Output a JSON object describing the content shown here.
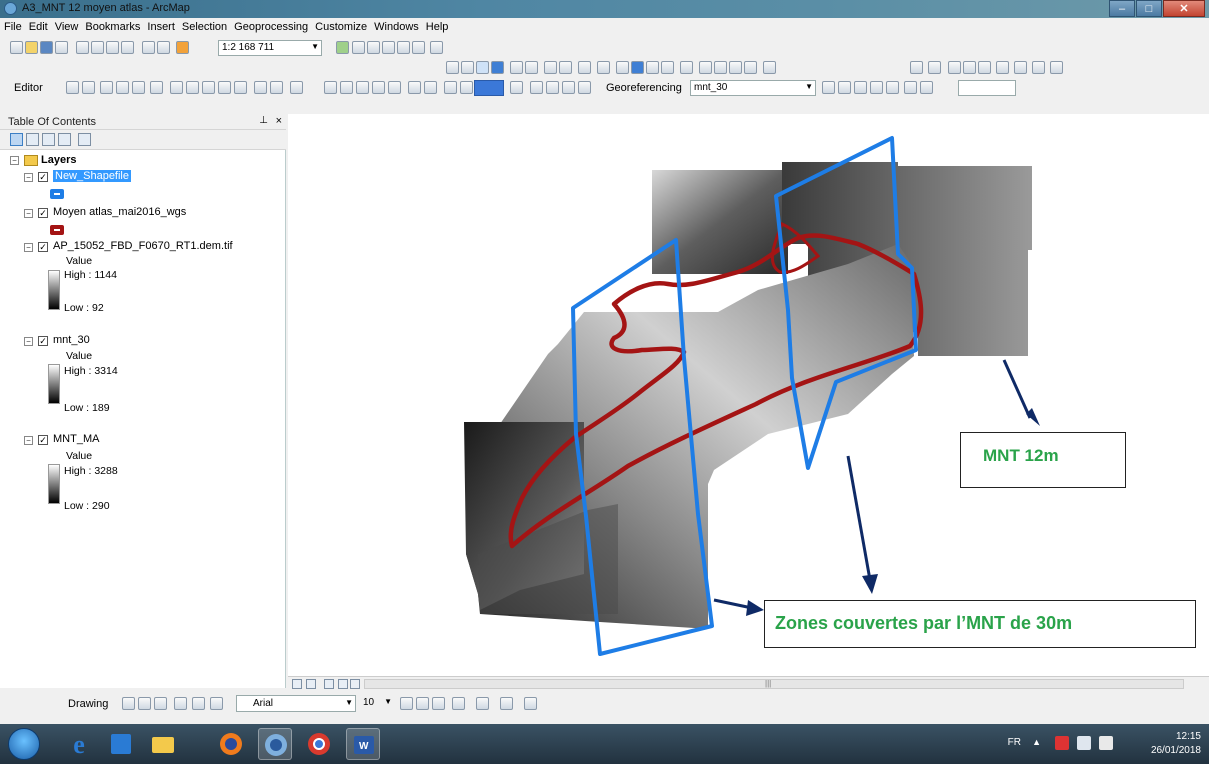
{
  "window": {
    "title": "A3_MNT 12 moyen atlas - ArcMap",
    "controls": [
      "minimize-icon",
      "maximize-icon",
      "close-icon"
    ]
  },
  "menu": [
    "File",
    "Edit",
    "View",
    "Bookmarks",
    "Insert",
    "Selection",
    "Geoprocessing",
    "Customize",
    "Windows",
    "Help"
  ],
  "toolbar": {
    "scale": "1:2 168 711",
    "editor_label": "Editor",
    "georeferencing_label": "Georeferencing",
    "georeferencing_layer": "mnt_30"
  },
  "toc": {
    "title": "Table Of Contents",
    "root": "Layers",
    "layers": [
      {
        "name": "New_Shapefile",
        "selected": true,
        "symbol_color": "#1e7de6"
      },
      {
        "name": "Moyen atlas_mai2016_wgs",
        "symbol_color": "#a41414"
      },
      {
        "name": "AP_15052_FBD_F0670_RT1.dem.tif",
        "value_label": "Value",
        "high": "High : 1144",
        "low": "Low : 92"
      },
      {
        "name": "mnt_30",
        "value_label": "Value",
        "high": "High : 3314",
        "low": "Low : 189"
      },
      {
        "name": "MNT_MA",
        "value_label": "Value",
        "high": "High : 3288",
        "low": "Low : 290"
      }
    ]
  },
  "map": {
    "callouts": {
      "mnt12": "MNT 12m",
      "zones": "Zones couvertes par l’MNT de 30m"
    },
    "colors": {
      "outline_blue": "#1e7de6",
      "outline_red": "#a41414",
      "callout_text": "#2aa34a",
      "arrow": "#0f2a66"
    }
  },
  "drawing": {
    "label": "Drawing",
    "font": "Arial",
    "font_size": "10"
  },
  "taskbar": {
    "lang": "FR",
    "time": "12:15",
    "date": "26/01/2018"
  }
}
